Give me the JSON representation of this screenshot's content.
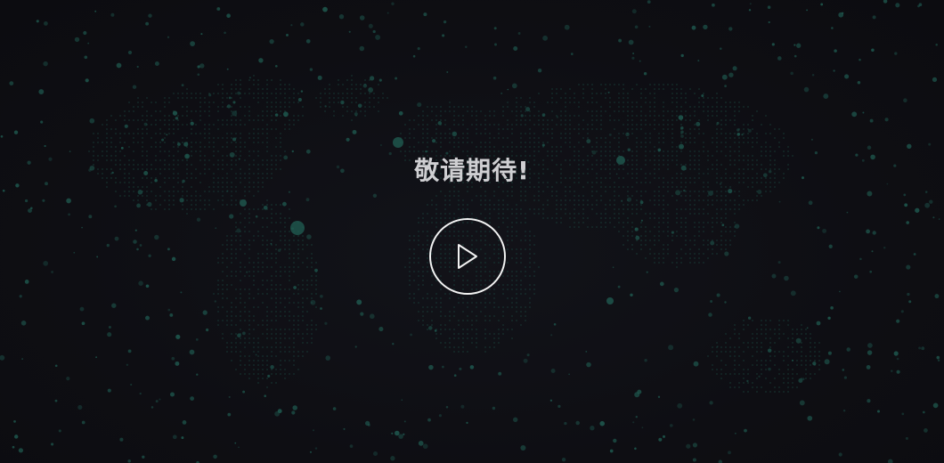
{
  "hero": {
    "headline": "敬请期待!",
    "play_icon": "play-icon"
  },
  "colors": {
    "background": "#0f0f14",
    "dot": "#1f5a50",
    "text": "#cfcfd2",
    "play_ring": "#f2f2f2"
  }
}
